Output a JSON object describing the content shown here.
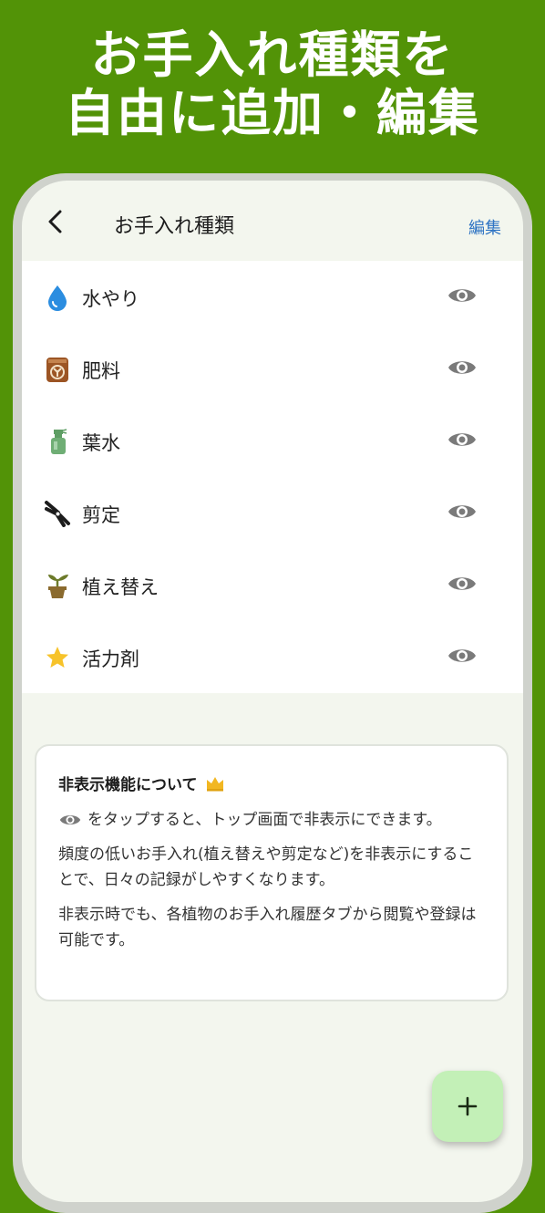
{
  "promo": {
    "line1": "お手入れ種類を",
    "line2": "自由に追加・編集"
  },
  "app_bar": {
    "back_icon": "chevron-left-icon",
    "title": "お手入れ種類",
    "edit_label": "編集",
    "edit_color": "#2f74c4"
  },
  "care_types": [
    {
      "label": "水やり",
      "icon": "water-drop-icon",
      "visibility_icon": "eye-icon"
    },
    {
      "label": "肥料",
      "icon": "fertilizer-bag-icon",
      "visibility_icon": "eye-icon"
    },
    {
      "label": "葉水",
      "icon": "spray-bottle-icon",
      "visibility_icon": "eye-icon"
    },
    {
      "label": "剪定",
      "icon": "pruning-shears-icon",
      "visibility_icon": "eye-icon"
    },
    {
      "label": "植え替え",
      "icon": "potted-plant-icon",
      "visibility_icon": "eye-icon"
    },
    {
      "label": "活力剤",
      "icon": "star-icon",
      "visibility_icon": "eye-icon"
    }
  ],
  "info": {
    "title": "非表示機能について",
    "title_icon": "crown-icon",
    "para1": "をタップすると、トップ画面で非表示にできます。",
    "para2": "頻度の低いお手入れ(植え替えや剪定など)を非表示にすることで、日々の記録がしやすくなります。",
    "para3": "非表示時でも、各植物のお手入れ履歴タブから閲覧や登録は可能です。"
  },
  "fab": {
    "icon": "plus-icon"
  },
  "colors": {
    "brand_green": "#529307",
    "screen_bg": "#f3f6ee",
    "fab_bg": "#c3f0b7",
    "eye_gray": "#7a7a7a"
  }
}
